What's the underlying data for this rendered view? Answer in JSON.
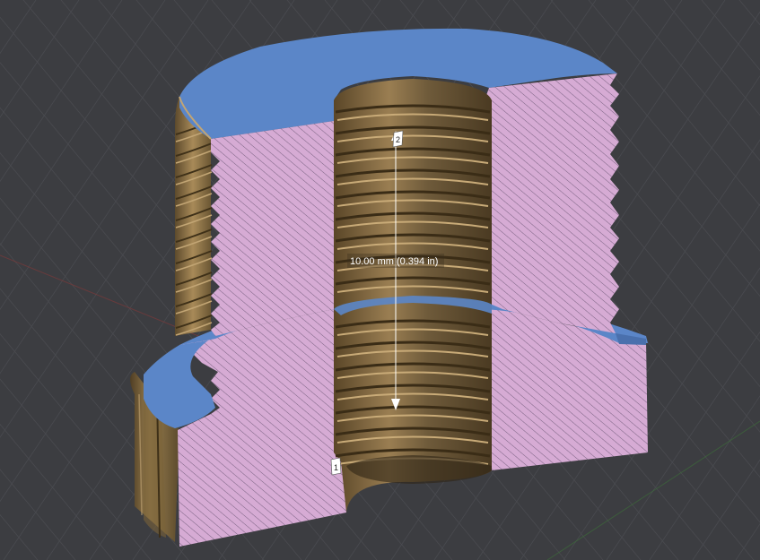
{
  "viewport": {
    "measurement": {
      "label": "10.00 mm (0.394 in)",
      "point_a": "1",
      "point_b": "2"
    },
    "colors": {
      "background": "#3c3d41",
      "grid_line": "#4a4b50",
      "section_face": "#d6abd4",
      "hatch": "#6e5a78",
      "cap_face": "#5b86c8",
      "metal_dark": "#4a3a22",
      "metal_mid": "#8a7048",
      "metal_light": "#b89a68",
      "axis_red": "#8a3a3a",
      "axis_green": "#3c6a3a"
    }
  }
}
